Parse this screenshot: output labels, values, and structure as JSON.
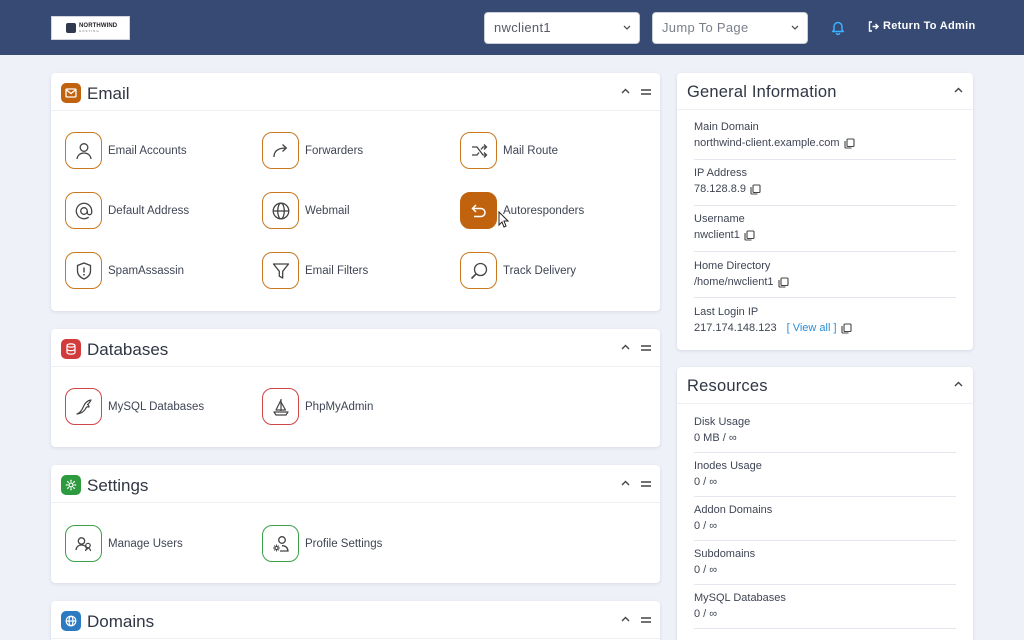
{
  "header": {
    "logo": {
      "name": "NORTHWIND",
      "subtitle": "HOSTING"
    },
    "account_select": "nwclient1",
    "jump_select": "Jump To Page",
    "return_label": "Return To Admin"
  },
  "colors": {
    "topbar": "#374a73",
    "email": "#c0620e",
    "databases": "#d13b3b",
    "settings": "#2e9a3f",
    "domains": "#2c7bc0",
    "link": "#2c8ed8"
  },
  "sections": {
    "email": {
      "title": "Email",
      "icon": "envelope-icon",
      "items": [
        {
          "label": "Email Accounts",
          "icon": "user-icon"
        },
        {
          "label": "Forwarders",
          "icon": "forward-arrow-icon"
        },
        {
          "label": "Mail Route",
          "icon": "route-icon"
        },
        {
          "label": "Default Address",
          "icon": "at-sign-icon"
        },
        {
          "label": "Webmail",
          "icon": "globe-icon"
        },
        {
          "label": "Autoresponders",
          "icon": "reply-icon",
          "state": "hovered"
        },
        {
          "label": "SpamAssassin",
          "icon": "shield-alert-icon"
        },
        {
          "label": "Email Filters",
          "icon": "funnel-icon"
        },
        {
          "label": "Track Delivery",
          "icon": "magnifier-icon"
        }
      ]
    },
    "databases": {
      "title": "Databases",
      "icon": "database-icon",
      "items": [
        {
          "label": "MySQL Databases",
          "icon": "dolphin-icon"
        },
        {
          "label": "PhpMyAdmin",
          "icon": "sailboat-icon"
        }
      ]
    },
    "settings": {
      "title": "Settings",
      "icon": "gear-icon",
      "items": [
        {
          "label": "Manage Users",
          "icon": "users-icon"
        },
        {
          "label": "Profile Settings",
          "icon": "user-gear-icon"
        }
      ]
    },
    "domains": {
      "title": "Domains",
      "icon": "globe-icon"
    }
  },
  "general_info": {
    "title": "General Information",
    "fields": [
      {
        "label": "Main Domain",
        "value": "northwind-client.example.com"
      },
      {
        "label": "IP Address",
        "value": "78.128.8.9"
      },
      {
        "label": "Username",
        "value": "nwclient1"
      },
      {
        "label": "Home Directory",
        "value": "/home/nwclient1"
      },
      {
        "label": "Last Login IP",
        "value": "217.174.148.123",
        "link": "[ View all ]"
      }
    ]
  },
  "resources": {
    "title": "Resources",
    "items": [
      {
        "label": "Disk Usage",
        "value": "0 MB / ∞"
      },
      {
        "label": "Inodes Usage",
        "value": "0 / ∞"
      },
      {
        "label": "Addon Domains",
        "value": "0 / ∞"
      },
      {
        "label": "Subdomains",
        "value": "0 / ∞"
      },
      {
        "label": "MySQL Databases",
        "value": "0 / ∞"
      }
    ]
  }
}
